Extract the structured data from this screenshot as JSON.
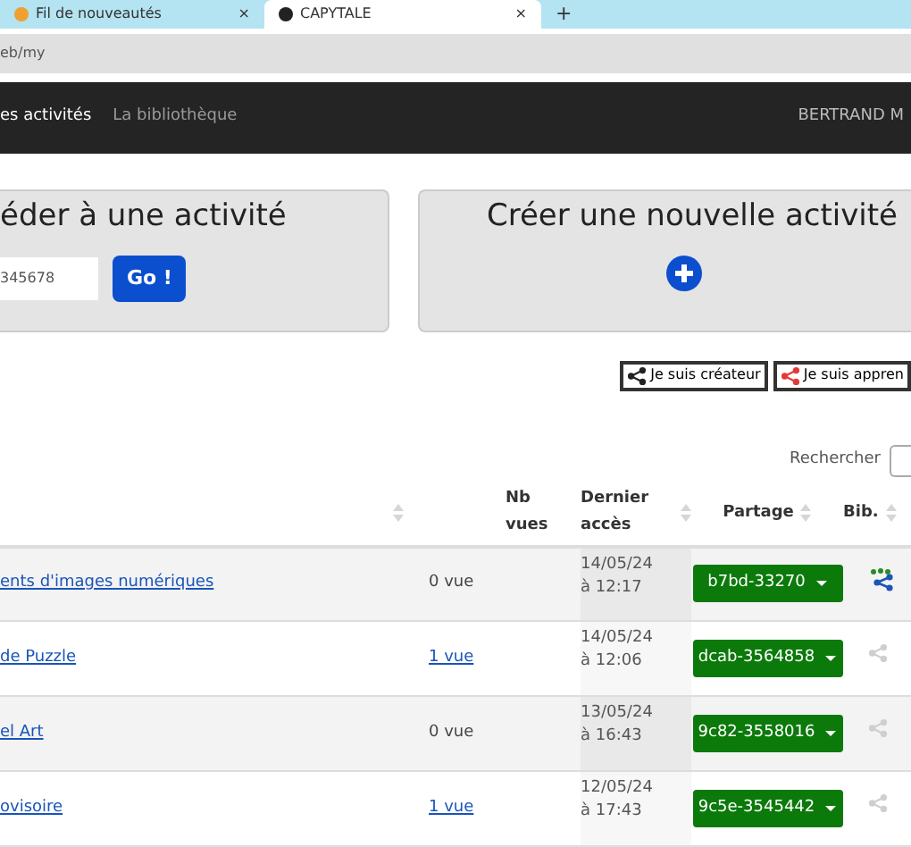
{
  "browser": {
    "tabs": [
      {
        "title": "Fil de nouveautés",
        "selected": false,
        "close": "×"
      },
      {
        "title": "CAPYTALE",
        "selected": true,
        "close": "×"
      }
    ],
    "new_tab": "+",
    "address": "eb/my"
  },
  "nav": {
    "items": [
      {
        "label": "es activités",
        "selected": true
      },
      {
        "label": "La bibliothèque",
        "selected": false
      }
    ],
    "user": "BERTRAND M"
  },
  "join_card": {
    "title": "éder à une activité",
    "code_value": "345678",
    "button": "Go !"
  },
  "create_card": {
    "title": "Créer une nouvelle activité"
  },
  "filters": [
    {
      "label": "Je suis créateur",
      "selected": false
    },
    {
      "label": "Je suis appren",
      "selected": false
    }
  ],
  "search": {
    "label": "Rechercher"
  },
  "table": {
    "columns": [
      "",
      "Nb vues",
      "Dernier accès",
      "Partage",
      "Bib."
    ],
    "rows": [
      {
        "title": "ents d'images numériques",
        "views": "0 vue",
        "views_link": false,
        "date": "14/05/24",
        "time": "à 12:17",
        "code": "b7bd-33270",
        "in_library": true
      },
      {
        "title": "de Puzzle",
        "views": "1 vue",
        "views_link": true,
        "date": "14/05/24",
        "time": "à 12:06",
        "code": "dcab-3564858",
        "in_library": false
      },
      {
        "title": "el Art",
        "views": "0 vue",
        "views_link": false,
        "date": "13/05/24",
        "time": "à 16:43",
        "code": "9c82-3558016",
        "in_library": false
      },
      {
        "title": "ovisoire",
        "views": "1 vue",
        "views_link": true,
        "date": "12/05/24",
        "time": "à 17:43",
        "code": "9c5e-3545442",
        "in_library": false
      }
    ]
  }
}
